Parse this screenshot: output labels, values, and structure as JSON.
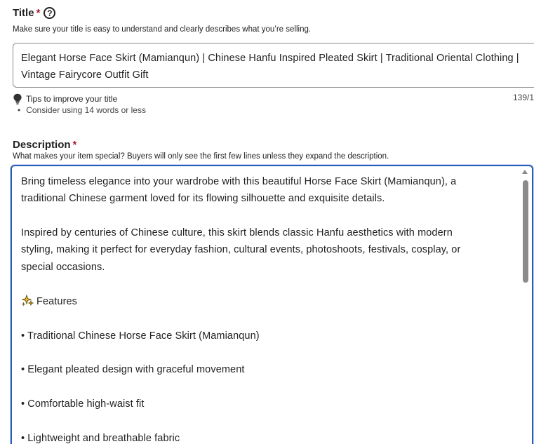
{
  "title_field": {
    "label": "Title",
    "required_mark": "*",
    "help_icon_glyph": "?",
    "hint": "Make sure your title is easy to understand and clearly describes what you’re selling.",
    "value": "Elegant Horse Face Skirt (Mamianqun) | Chinese Hanfu Inspired Pleated Skirt | Traditional Oriental Clothing | Vintage Fairycore Outfit Gift",
    "tips_heading": "Tips to improve your title",
    "tips": [
      "Consider using 14 words or less"
    ],
    "char_counter": "139/1"
  },
  "description_field": {
    "label": "Description",
    "required_mark": "*",
    "hint": "What makes your item special? Buyers will only see the first few lines unless they expand the description.",
    "paragraphs": {
      "p1_line1": "Bring timeless elegance into your wardrobe with this beautiful Horse Face Skirt (Mamianqun), a",
      "p1_line2": "traditional Chinese garment loved for its flowing silhouette and exquisite details.",
      "p2_line1": "Inspired by centuries of Chinese culture, this skirt blends classic Hanfu aesthetics with modern",
      "p2_line2": "styling, making it perfect for everyday fashion, cultural events, photoshoots, festivals, cosplay, or",
      "p2_line3": "special occasions.",
      "features_heading": "Features",
      "bullet1": "• Traditional Chinese Horse Face Skirt (Mamianqun)",
      "bullet2": "• Elegant pleated design with graceful movement",
      "bullet3": "• Comfortable high-waist fit",
      "bullet4": "• Lightweight and breathable fabric"
    }
  },
  "colors": {
    "required": "#a61a2e",
    "focus_border": "#2a5bb6"
  },
  "icons": {
    "help": "question-circle-icon",
    "tips": "lightbulb-icon",
    "features": "sparkles-icon"
  }
}
